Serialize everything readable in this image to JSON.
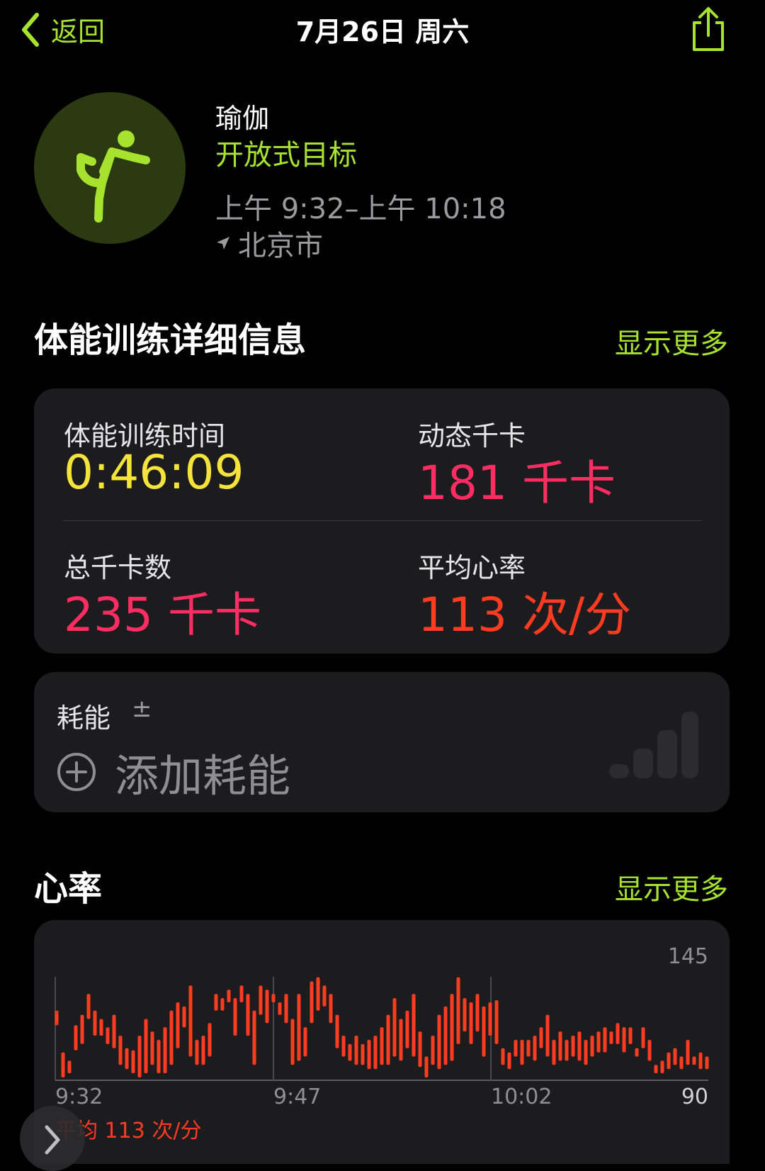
{
  "nav": {
    "back_label": "返回",
    "title": "7月26日 周六"
  },
  "workout": {
    "type": "瑜伽",
    "goal": "开放式目标",
    "time_range": "上午 9:32–上午 10:18",
    "location": "北京市"
  },
  "details": {
    "section_title": "体能训练详细信息",
    "show_more": "显示更多",
    "metrics": [
      {
        "label": "体能训练时间",
        "value": "0:46:09",
        "color": "#f4e33a"
      },
      {
        "label": "动态千卡",
        "value": "181 千卡",
        "color": "#ff2d62"
      },
      {
        "label": "总千卡数",
        "value": "235 千卡",
        "color": "#ff2d62"
      },
      {
        "label": "平均心率",
        "value": "113 次/分",
        "color": "#ff3b21"
      }
    ]
  },
  "effort": {
    "label": "耗能",
    "plus_minus": "±",
    "add_label": "添加耗能"
  },
  "heart_rate": {
    "section_title": "心率",
    "show_more": "显示更多",
    "avg_text": "平均 113 次/分"
  },
  "chart_data": {
    "type": "bar",
    "ylim": [
      90,
      145
    ],
    "y_top_label": "145",
    "y_bottom_label": "90",
    "x_labels": [
      "9:32",
      "9:47",
      "10:02"
    ],
    "bar_color": "#ff3b21",
    "ranges": [
      [
        115,
        122
      ],
      [
        90,
        102
      ],
      [
        92,
        98
      ],
      [
        103,
        115
      ],
      [
        106,
        120
      ],
      [
        118,
        130
      ],
      [
        110,
        122
      ],
      [
        110,
        118
      ],
      [
        106,
        114
      ],
      [
        104,
        120
      ],
      [
        96,
        110
      ],
      [
        94,
        104
      ],
      [
        92,
        103
      ],
      [
        90,
        110
      ],
      [
        92,
        118
      ],
      [
        96,
        112
      ],
      [
        92,
        108
      ],
      [
        92,
        114
      ],
      [
        96,
        122
      ],
      [
        104,
        126
      ],
      [
        114,
        124
      ],
      [
        100,
        134
      ],
      [
        96,
        108
      ],
      [
        96,
        110
      ],
      [
        100,
        116
      ],
      [
        122,
        130
      ],
      [
        122,
        128
      ],
      [
        126,
        132
      ],
      [
        110,
        128
      ],
      [
        126,
        134
      ],
      [
        110,
        130
      ],
      [
        96,
        122
      ],
      [
        120,
        134
      ],
      [
        116,
        132
      ],
      [
        126,
        130
      ],
      [
        120,
        126
      ],
      [
        116,
        130
      ],
      [
        96,
        118
      ],
      [
        98,
        130
      ],
      [
        100,
        114
      ],
      [
        116,
        136
      ],
      [
        122,
        138
      ],
      [
        124,
        134
      ],
      [
        116,
        130
      ],
      [
        104,
        120
      ],
      [
        100,
        110
      ],
      [
        98,
        106
      ],
      [
        96,
        110
      ],
      [
        96,
        106
      ],
      [
        94,
        108
      ],
      [
        94,
        110
      ],
      [
        96,
        114
      ],
      [
        96,
        120
      ],
      [
        100,
        128
      ],
      [
        98,
        118
      ],
      [
        104,
        122
      ],
      [
        100,
        130
      ],
      [
        95,
        112
      ],
      [
        90,
        100
      ],
      [
        96,
        110
      ],
      [
        94,
        120
      ],
      [
        96,
        124
      ],
      [
        98,
        130
      ],
      [
        106,
        138
      ],
      [
        112,
        128
      ],
      [
        106,
        126
      ],
      [
        112,
        130
      ],
      [
        100,
        124
      ],
      [
        110,
        126
      ],
      [
        106,
        127
      ],
      [
        96,
        104
      ],
      [
        94,
        102
      ],
      [
        100,
        108
      ],
      [
        96,
        108
      ],
      [
        100,
        108
      ],
      [
        98,
        110
      ],
      [
        104,
        114
      ],
      [
        100,
        120
      ],
      [
        96,
        108
      ],
      [
        98,
        112
      ],
      [
        98,
        108
      ],
      [
        100,
        110
      ],
      [
        98,
        112
      ],
      [
        96,
        108
      ],
      [
        100,
        110
      ],
      [
        102,
        112
      ],
      [
        102,
        114
      ],
      [
        106,
        112
      ],
      [
        106,
        116
      ],
      [
        102,
        114
      ],
      [
        106,
        114
      ],
      [
        100,
        104
      ],
      [
        104,
        114
      ],
      [
        98,
        108
      ],
      [
        92,
        96
      ],
      [
        92,
        98
      ],
      [
        94,
        102
      ],
      [
        96,
        104
      ],
      [
        94,
        100
      ],
      [
        96,
        108
      ],
      [
        96,
        100
      ],
      [
        94,
        102
      ],
      [
        94,
        100
      ]
    ]
  }
}
